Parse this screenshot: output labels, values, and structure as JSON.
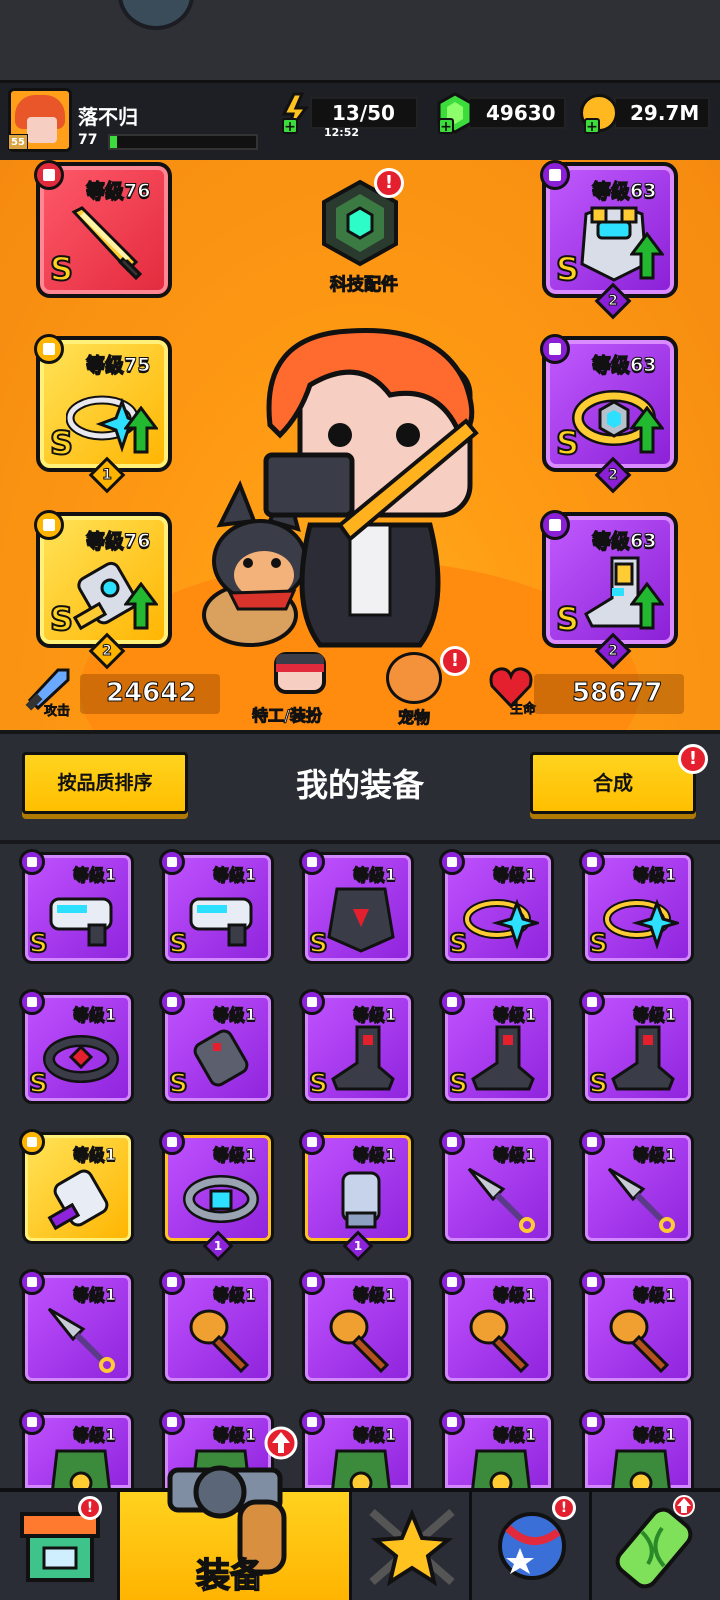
{
  "header": {
    "avatar_level": "55",
    "player_name": "落不归",
    "player_xp": "77",
    "xp_progress": 0.05,
    "energy": "13/50",
    "energy_timer": "12:52",
    "gems": "49630",
    "coins": "29.7M"
  },
  "equipped": {
    "tech_parts_label": "科技配件",
    "slots": [
      {
        "id": "weapon",
        "level": "等级76",
        "grade": "S",
        "rarity": "red",
        "icon": "sword-icon"
      },
      {
        "id": "necklace",
        "level": "等级75",
        "grade": "S",
        "rarity": "gold",
        "icon": "ring-icon",
        "count": "1"
      },
      {
        "id": "gloves",
        "level": "等级76",
        "grade": "S",
        "rarity": "gold",
        "icon": "gauntlet-icon",
        "count": "2"
      },
      {
        "id": "armor",
        "level": "等级63",
        "grade": "S",
        "rarity": "purple",
        "icon": "armor-icon",
        "count": "2"
      },
      {
        "id": "belt",
        "level": "等级63",
        "grade": "S",
        "rarity": "purple",
        "icon": "belt-icon",
        "count": "2"
      },
      {
        "id": "boots",
        "level": "等级63",
        "grade": "S",
        "rarity": "purple",
        "icon": "boot-icon",
        "count": "2"
      }
    ]
  },
  "stats": {
    "attack_label": "攻击",
    "attack_value": "24642",
    "agent_label": "特工/装扮",
    "pet_label": "宠物",
    "hp_label": "生命",
    "hp_value": "58677"
  },
  "inventory": {
    "sort_label": "按品质排序",
    "title": "我的装备",
    "merge_label": "合成",
    "items": [
      {
        "level": "等级1",
        "grade": "S",
        "rarity": "purple",
        "icon": "blaster-icon"
      },
      {
        "level": "等级1",
        "grade": "S",
        "rarity": "purple",
        "icon": "blaster-icon"
      },
      {
        "level": "等级1",
        "grade": "S",
        "rarity": "purple",
        "icon": "dark-armor-icon"
      },
      {
        "level": "等级1",
        "grade": "S",
        "rarity": "purple",
        "icon": "ring-icon"
      },
      {
        "level": "等级1",
        "grade": "S",
        "rarity": "purple",
        "icon": "ring-icon"
      },
      {
        "level": "等级1",
        "grade": "S",
        "rarity": "purple",
        "icon": "dark-belt-icon"
      },
      {
        "level": "等级1",
        "grade": "S",
        "rarity": "purple",
        "icon": "dark-gauntlet-icon"
      },
      {
        "level": "等级1",
        "grade": "S",
        "rarity": "purple",
        "icon": "dark-boot-icon"
      },
      {
        "level": "等级1",
        "grade": "S",
        "rarity": "purple",
        "icon": "dark-boot-icon"
      },
      {
        "level": "等级1",
        "grade": "S",
        "rarity": "purple",
        "icon": "dark-boot-icon"
      },
      {
        "level": "等级1",
        "grade": "",
        "rarity": "gold",
        "icon": "purple-gauntlet-icon"
      },
      {
        "level": "等级1",
        "grade": "",
        "rarity": "purple-gold",
        "icon": "silver-belt-icon",
        "count": "1"
      },
      {
        "level": "等级1",
        "grade": "",
        "rarity": "purple-gold",
        "icon": "silver-gauntlet-icon",
        "count": "1"
      },
      {
        "level": "等级1",
        "grade": "",
        "rarity": "purple",
        "icon": "kunai-icon"
      },
      {
        "level": "等级1",
        "grade": "",
        "rarity": "purple",
        "icon": "kunai-icon"
      },
      {
        "level": "等级1",
        "grade": "",
        "rarity": "purple",
        "icon": "kunai-icon"
      },
      {
        "level": "等级1",
        "grade": "",
        "rarity": "purple",
        "icon": "horn-icon"
      },
      {
        "level": "等级1",
        "grade": "",
        "rarity": "purple",
        "icon": "horn-icon"
      },
      {
        "level": "等级1",
        "grade": "",
        "rarity": "purple",
        "icon": "horn-icon"
      },
      {
        "level": "等级1",
        "grade": "",
        "rarity": "purple",
        "icon": "horn-icon"
      },
      {
        "level": "等级1",
        "grade": "",
        "rarity": "purple",
        "icon": "leaf-armor-icon"
      },
      {
        "level": "等级1",
        "grade": "",
        "rarity": "purple",
        "icon": "leaf-armor-icon"
      },
      {
        "level": "等级1",
        "grade": "",
        "rarity": "purple",
        "icon": "leaf-armor-icon"
      },
      {
        "level": "等级1",
        "grade": "",
        "rarity": "purple",
        "icon": "leaf-armor-icon"
      },
      {
        "level": "等级1",
        "grade": "",
        "rarity": "purple",
        "icon": "leaf-armor-icon"
      }
    ]
  },
  "nav": {
    "equip_label": "装备",
    "tabs": [
      "shop-icon",
      "gun-icon",
      "star-swords-icon",
      "ball-icon",
      "dna-capsule-icon"
    ]
  },
  "colors": {
    "gold_rarity": "#ffb400",
    "purple_rarity": "#8e23dc",
    "red_rarity": "#e22a3d",
    "hero_background": "#ff9b14"
  }
}
